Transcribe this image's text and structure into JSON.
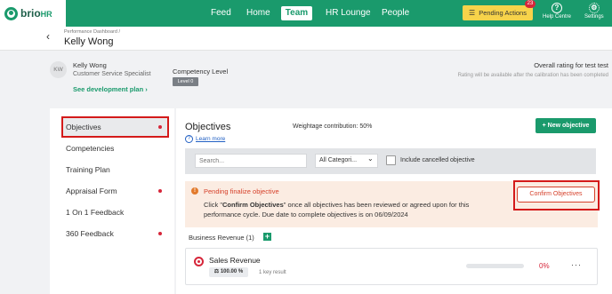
{
  "brand": {
    "logo_main": "brio",
    "logo_suffix": "HR",
    "accent": "#1a9a6c",
    "alert_color": "#d6263a"
  },
  "nav": {
    "items": [
      "Feed",
      "Home",
      "Team",
      "HR Lounge",
      "People"
    ],
    "active": "Team",
    "pending_actions": {
      "label": "Pending Actions",
      "count": "23"
    },
    "help": {
      "label": "Help Centre",
      "icon": "question-icon"
    },
    "settings": {
      "label": "Settings",
      "icon": "gear-icon"
    }
  },
  "header": {
    "breadcrumb": "Performance Dashboard /",
    "title": "Kelly Wong"
  },
  "profile": {
    "initials": "KW",
    "name": "Kelly Wong",
    "role": "Customer Service Specialist",
    "dev_plan_link": "See development plan",
    "competency_label": "Competency Level",
    "level_badge": "Level 0",
    "overall_title": "Overall rating for test test",
    "overall_note": "Rating will be available after the calibration has been completed"
  },
  "sidebar": {
    "items": [
      {
        "label": "Objectives",
        "dot": true
      },
      {
        "label": "Competencies",
        "dot": false
      },
      {
        "label": "Training Plan",
        "dot": false
      },
      {
        "label": "Appraisal Form",
        "dot": true
      },
      {
        "label": "1 On 1 Feedback",
        "dot": false
      },
      {
        "label": "360 Feedback",
        "dot": true
      }
    ],
    "active": "Objectives"
  },
  "objectives": {
    "title": "Objectives",
    "weightage": "Weightage contribution: 50%",
    "learn_more": "Learn more",
    "new_button": "+ New objective",
    "filters": {
      "search_placeholder": "Search...",
      "category_value": "All Categori...",
      "include_cancelled_label": "Include cancelled objective",
      "include_cancelled_checked": false
    },
    "alert": {
      "title": "Pending finalize objective",
      "body_prefix": "Click \"",
      "body_bold": "Confirm Objectives",
      "body_suffix": "\" once all objectives has been reviewed or agreed upon for this performance cycle. Due date to complete objectives is on 06/09/2024",
      "confirm_button": "Confirm Objectives"
    },
    "group": {
      "label": "Business Revenue (1)",
      "add_icon": "plus-icon"
    },
    "card": {
      "title": "Sales Revenue",
      "weight": "100.00 %",
      "key_results": "1 key result",
      "progress": 0,
      "progress_label": "0%",
      "more": "···"
    }
  }
}
